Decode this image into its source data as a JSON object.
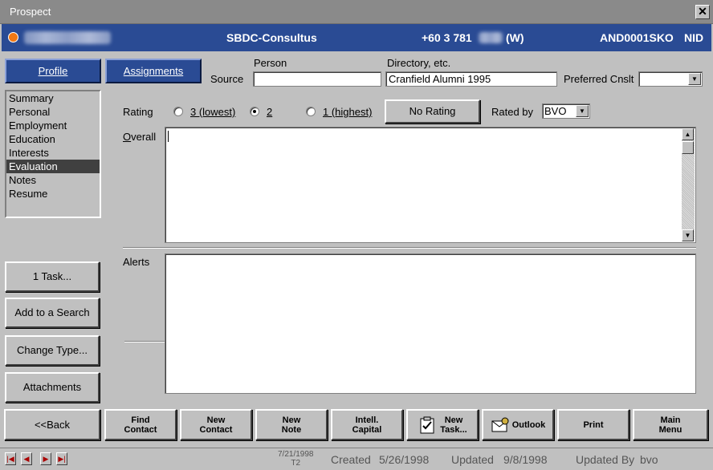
{
  "window": {
    "title": "Prospect",
    "close_label": "✕"
  },
  "header": {
    "org": "SBDC-Consultus",
    "phone": "+60 3 781",
    "phone_suffix": "(W)",
    "code": "AND0001SKO",
    "nid": "NID"
  },
  "tabs": {
    "profile": "Profile",
    "assignments": "Assignments"
  },
  "source": {
    "label": "Source",
    "person_label": "Person",
    "person_value": "",
    "directory_label": "Directory, etc.",
    "directory_value": "Cranfield Alumni 1995",
    "preferred_label": "Preferred Cnslt",
    "preferred_value": ""
  },
  "nav": {
    "items": [
      "Summary",
      "Personal",
      "Employment",
      "Education",
      "Interests",
      "Evaluation",
      "Notes",
      "Resume"
    ],
    "selected": "Evaluation"
  },
  "rating": {
    "label": "Rating",
    "options": [
      "3 (lowest)",
      "2",
      "1 (highest)"
    ],
    "selected": "2",
    "no_rating": "No Rating",
    "rated_by_label": "Rated by",
    "rated_by_value": "BVO"
  },
  "overall": {
    "label": "Overall",
    "value": ""
  },
  "alerts": {
    "label": "Alerts",
    "value": ""
  },
  "side_buttons": {
    "task": "1 Task...",
    "add_search": "Add to a Search",
    "change_type": "Change Type...",
    "attachments": "Attachments"
  },
  "toolbar": {
    "back": "<<Back",
    "find_contact": [
      "Find",
      "Contact"
    ],
    "new_contact": [
      "New",
      "Contact"
    ],
    "new_note": [
      "New",
      "Note"
    ],
    "intell_capital": [
      "Intell.",
      "Capital"
    ],
    "new_task": [
      "New",
      "Task..."
    ],
    "outlook": "Outlook",
    "print": "Print",
    "main_menu": [
      "Main",
      "Menu"
    ]
  },
  "status": {
    "date": "7/21/1998",
    "t": "T2",
    "created_label": "Created",
    "created": "5/26/1998",
    "updated_label": "Updated",
    "updated": "9/8/1998",
    "updated_by_label": "Updated By",
    "updated_by": "bvo"
  },
  "colors": {
    "header_bg": "#2a4b94",
    "accent_orange": "#f07814",
    "face": "#c0c0c0"
  }
}
